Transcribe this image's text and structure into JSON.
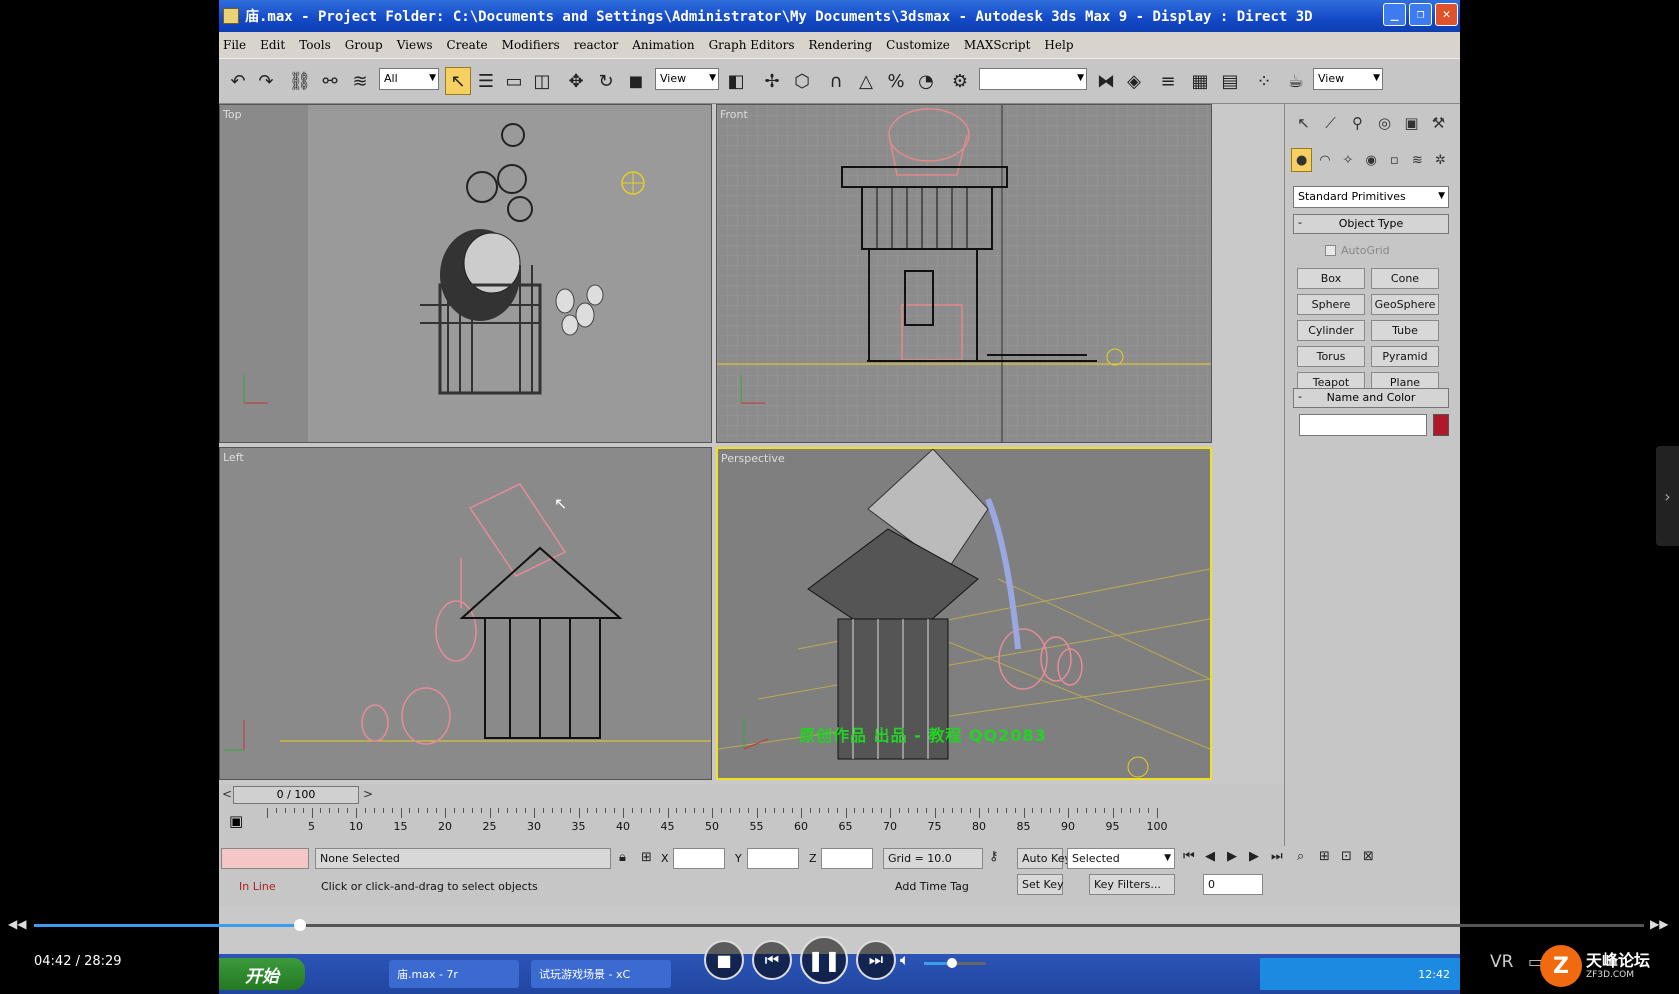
{
  "window": {
    "title": "庙.max   - Project Folder: C:\\Documents and Settings\\Administrator\\My Documents\\3dsmax   - Autodesk 3ds Max 9   - Display : Direct 3D",
    "minimize": "_",
    "restore": "❐",
    "close": "✕"
  },
  "menu": [
    "File",
    "Edit",
    "Tools",
    "Group",
    "Views",
    "Create",
    "Modifiers",
    "reactor",
    "Animation",
    "Graph Editors",
    "Rendering",
    "Customize",
    "MAXScript",
    "Help"
  ],
  "toolbar": {
    "selection_filter": "All",
    "coord_system": "View",
    "named_selection": "",
    "render_type": "View"
  },
  "viewports": {
    "top": "Top",
    "front": "Front",
    "left": "Left",
    "perspective": "Perspective"
  },
  "command_panel": {
    "category": "Standard Primitives",
    "object_type_title": "Object Type",
    "autogrid": "AutoGrid",
    "buttons": [
      "Box",
      "Cone",
      "Sphere",
      "GeoSphere",
      "Cylinder",
      "Tube",
      "Torus",
      "Pyramid",
      "Teapot",
      "Plane"
    ],
    "name_color_title": "Name and Color",
    "object_color": "#b0182e"
  },
  "timeline": {
    "frame_display": "0 / 100",
    "ticks": [
      "5",
      "10",
      "15",
      "20",
      "25",
      "30",
      "35",
      "40",
      "45",
      "50",
      "55",
      "60",
      "65",
      "70",
      "75",
      "80",
      "85",
      "90",
      "95",
      "100"
    ]
  },
  "status": {
    "selection": "None Selected",
    "prompt": "Click or click-and-drag to select objects",
    "x_label": "X",
    "y_label": "Y",
    "z_label": "Z",
    "grid": "Grid = 10.0",
    "autokey": "Auto Key",
    "autokey_mode": "Selected",
    "setkey": "Set Key",
    "key_filters": "Key Filters...",
    "add_time_tag": "Add Time Tag",
    "frame": "0",
    "in_line": "In Line"
  },
  "taskbar": {
    "start": "开始",
    "task1": "庙.max     - 7r",
    "task2": "试玩游戏场景 - xC",
    "clock": "12:42"
  },
  "watermark": "原创作品 出品 - 教程 QQ2083",
  "player": {
    "time": "04:42 / 28:29",
    "progress": 0.165,
    "volume": 0.45,
    "vr": "VR",
    "brand": "天峰论坛",
    "brand_sub": "ZF3D.COM"
  }
}
